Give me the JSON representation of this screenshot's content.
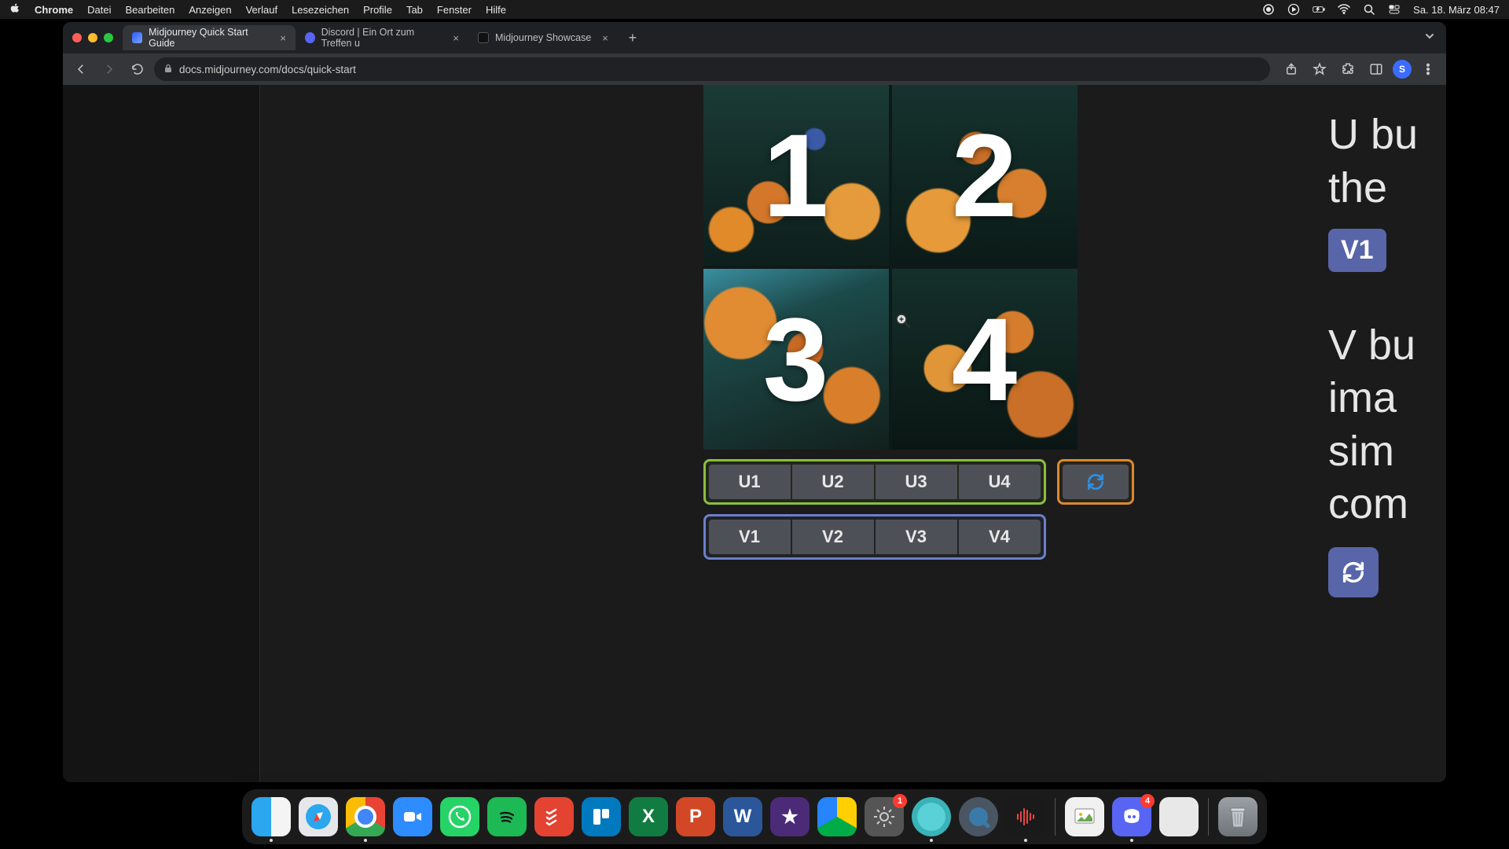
{
  "menubar": {
    "app": "Chrome",
    "items": [
      "Datei",
      "Bearbeiten",
      "Anzeigen",
      "Verlauf",
      "Lesezeichen",
      "Profile",
      "Tab",
      "Fenster",
      "Hilfe"
    ],
    "clock": "Sa. 18. März  08:47"
  },
  "tabs": [
    {
      "title": "Midjourney Quick Start Guide",
      "active": true
    },
    {
      "title": "Discord | Ein Ort zum Treffen u",
      "active": false
    },
    {
      "title": "Midjourney Showcase",
      "active": false
    }
  ],
  "url": "docs.midjourney.com/docs/quick-start",
  "avatar_initial": "S",
  "grid_numbers": [
    "1",
    "2",
    "3",
    "4"
  ],
  "u_buttons": [
    "U1",
    "U2",
    "U3",
    "U4"
  ],
  "v_buttons": [
    "V1",
    "V2",
    "V3",
    "V4"
  ],
  "side_text": {
    "line1": "U bu",
    "line2": "the",
    "badge": "V1",
    "line3": "V bu",
    "line4": "ima",
    "line5": "sim",
    "line6": "com"
  },
  "dock": {
    "settings_badge": "1",
    "discord_badge": "4"
  }
}
